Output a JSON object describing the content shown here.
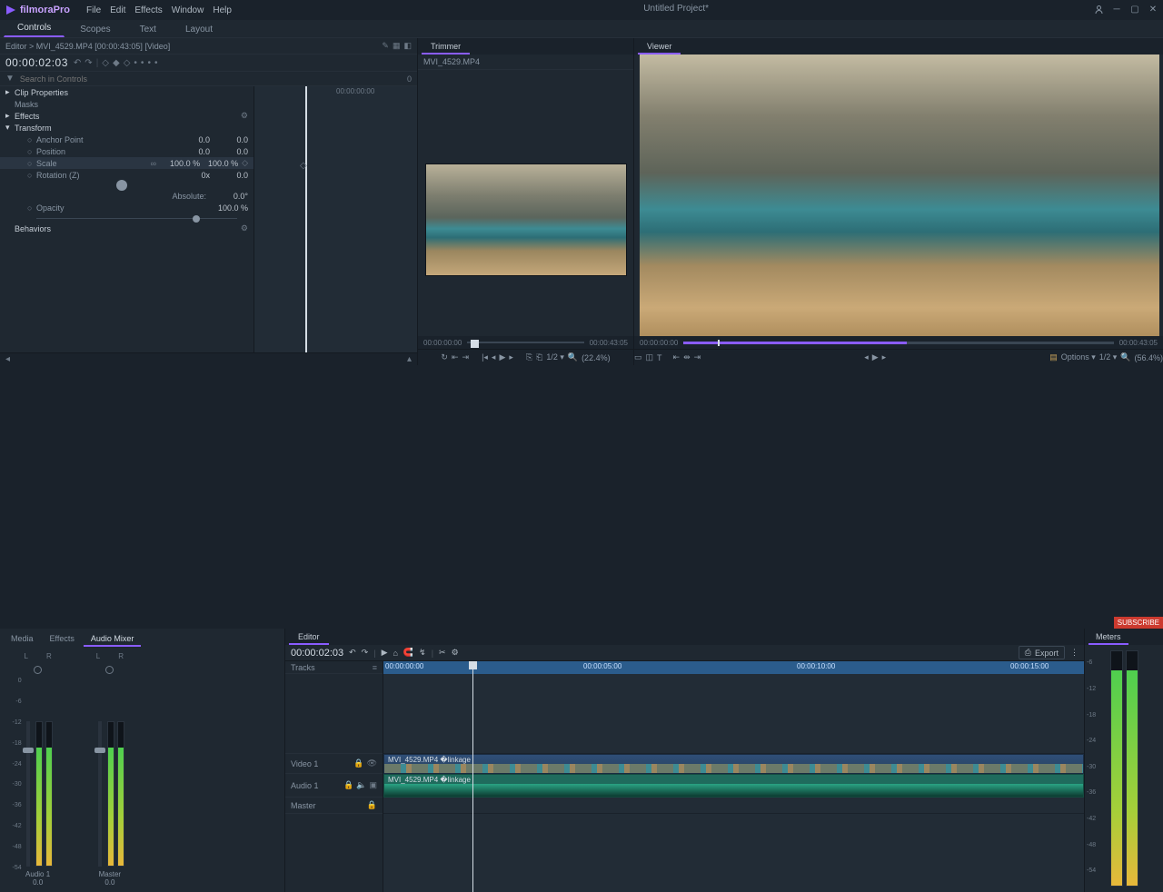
{
  "app": {
    "name": "filmoraPro",
    "project_title": "Untitled Project*"
  },
  "menu": [
    "File",
    "Edit",
    "Effects",
    "Window",
    "Help"
  ],
  "workspace_tabs": [
    "Controls",
    "Scopes",
    "Text",
    "Layout"
  ],
  "controls": {
    "breadcrumb": "Editor > MVI_4529.MP4 [00:00:43:05] [Video]",
    "timecode": "00:00:02:03",
    "search_placeholder": "Search in Controls",
    "search_marker": "0",
    "kf_ruler_label": "00:00:00:00",
    "sections": {
      "clip_properties": "Clip Properties",
      "masks": "Masks",
      "effects": "Effects",
      "transform": "Transform",
      "behaviors": "Behaviors"
    },
    "transform": {
      "anchor_point": {
        "label": "Anchor Point",
        "x": "0.0",
        "y": "0.0"
      },
      "position": {
        "label": "Position",
        "x": "0.0",
        "y": "0.0"
      },
      "scale": {
        "label": "Scale",
        "x": "100.0 %",
        "y": "100.0 %"
      },
      "rotation": {
        "label": "Rotation (Z)",
        "turns": "0x",
        "deg": "0.0"
      },
      "absolute_row": {
        "label": "Absolute:",
        "value": "0.0°"
      },
      "opacity": {
        "label": "Opacity",
        "value": "100.0 %"
      }
    }
  },
  "trimmer": {
    "tab": "Trimmer",
    "filename": "MVI_4529.MP4",
    "time_left": "00:00:00:00",
    "time_right": "00:00:43:05",
    "scale_label": "1/2 ▾",
    "zoom": "(22.4%)"
  },
  "viewer": {
    "tab": "Viewer",
    "time_left": "00:00:00:00",
    "time_right": "00:00:43:05",
    "options_label": "Options ▾",
    "scale_label": "1/2 ▾",
    "zoom": "(56.4%)"
  },
  "mixer": {
    "tabs": [
      "Media",
      "Effects",
      "Audio Mixer"
    ],
    "active_tab": 2,
    "channels": [
      {
        "name": "Audio 1",
        "value": "0.0",
        "L": "L",
        "R": "R",
        "level_pct": 82,
        "fader_top_pct": 18
      },
      {
        "name": "Master",
        "value": "0.0",
        "L": "L",
        "R": "R",
        "level_pct": 82,
        "fader_top_pct": 18
      }
    ],
    "scale": [
      "0",
      "-6",
      "-12",
      "-18",
      "-24",
      "-30",
      "-36",
      "-42",
      "-48",
      "-54"
    ]
  },
  "editor": {
    "tab": "Editor",
    "timecode": "00:00:02:03",
    "export_label": "Export",
    "tracks_label": "Tracks",
    "ruler": [
      "00:00:00:00",
      "00:00:05:00",
      "00:00:10:00",
      "00:00:15:00"
    ],
    "video_track": {
      "name": "Video 1",
      "clip_label": "MVI_4529.MP4  �linkage"
    },
    "audio_track": {
      "name": "Audio 1",
      "clip_label": "MVI_4529.MP4  �linkage"
    },
    "master_track": {
      "name": "Master"
    }
  },
  "meters": {
    "tab": "Meters",
    "scale": [
      "-6",
      "-12",
      "-18",
      "-24",
      "-30",
      "-36",
      "-42",
      "-48",
      "-54"
    ],
    "level_pct": 92
  },
  "badge": "SUBSCRIBE"
}
